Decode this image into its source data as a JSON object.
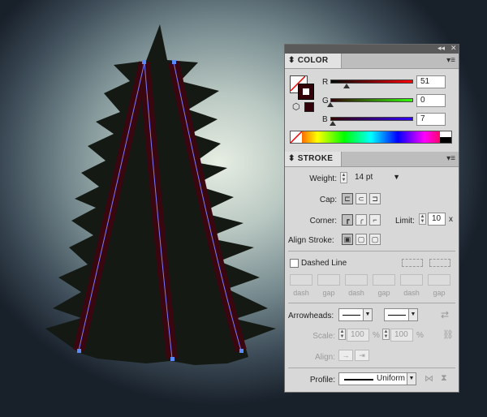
{
  "color_panel": {
    "tab_label": "COLOR",
    "channels": [
      {
        "label": "R",
        "value": "51",
        "fraction": 0.2
      },
      {
        "label": "G",
        "value": "0",
        "fraction": 0.0
      },
      {
        "label": "B",
        "value": "7",
        "fraction": 0.027
      }
    ],
    "fill_color": "#33000a",
    "stroke_color": "#33000a"
  },
  "stroke_panel": {
    "tab_label": "STROKE",
    "weight_label": "Weight:",
    "weight_value": "14 pt",
    "cap_label": "Cap:",
    "corner_label": "Corner:",
    "limit_label": "Limit:",
    "limit_value": "10",
    "limit_unit": "x",
    "align_label": "Align Stroke:",
    "dashed_label": "Dashed Line",
    "dash_labels": [
      "dash",
      "gap",
      "dash",
      "gap",
      "dash",
      "gap"
    ],
    "arrowheads_label": "Arrowheads:",
    "scale_label": "Scale:",
    "scale_start": "100",
    "scale_end": "100",
    "percent": "%",
    "align_arrow_label": "Align:",
    "profile_label": "Profile:",
    "profile_value": "Uniform"
  },
  "colors": {
    "tree": "#151a14",
    "stroke": "#3a0610",
    "path": "#7a7aff",
    "anchor": "#5b8aff"
  }
}
